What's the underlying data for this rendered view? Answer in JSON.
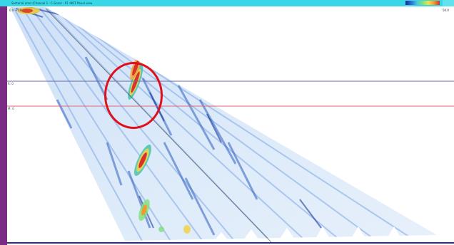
{
  "window": {
    "title": "Sectorial scan (Channel 1 - C-Scan) - P1 :NDT Panel view"
  },
  "cursors": {
    "reference_label": "R: 0",
    "measure_label": "M: 0",
    "reference_color": "#6c6ca8",
    "measure_color": "#e06a7a"
  },
  "scale": {
    "top_label": "0.0 → 10",
    "right_label": "50.0"
  },
  "palette": [
    "#1e2a8a",
    "#2d6cd6",
    "#49c4e0",
    "#7fe07a",
    "#f2e04a",
    "#f39a2b",
    "#d8322a"
  ],
  "annotation": {
    "shape": "circle",
    "color": "#e0101a"
  },
  "colors": {
    "titlebar": "#38d6e6",
    "ruler": "#7a2b84",
    "background": "#ffffff"
  }
}
